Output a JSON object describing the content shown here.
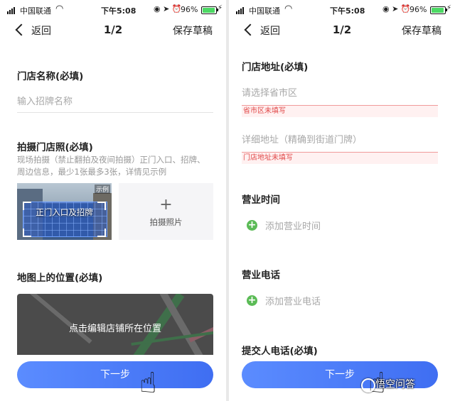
{
  "status_bar": {
    "carrier": "中国联通",
    "time": "下午5:08",
    "battery_pct": "96%",
    "battery_level": 0.96
  },
  "nav": {
    "back_label": "返回",
    "page": "1/2",
    "save_draft": "保存草稿"
  },
  "left": {
    "store_name": {
      "label": "门店名称(必填)",
      "placeholder": "输入招牌名称"
    },
    "photo": {
      "label": "拍摄门店照(必填)",
      "description": "现场拍摄（禁止翻拍及夜间拍摄）正门入口、招牌、周边信息，最少1张最多3张，详情见示例",
      "sample_caption": "正门入口及招牌",
      "sample_tag": "示例",
      "add_label": "拍摄照片",
      "add_symbol": "+"
    },
    "map": {
      "label": "地图上的位置(必填)",
      "hint": "点击编辑店铺所在位置"
    },
    "next": "下一步"
  },
  "right": {
    "address": {
      "label": "门店地址(必填)",
      "region_placeholder": "请选择省市区",
      "region_error": "省市区未填写",
      "detail_placeholder": "详细地址（精确到街道门牌）",
      "detail_error": "门店地址未填写"
    },
    "hours": {
      "label": "营业时间",
      "add": "添加营业时间"
    },
    "phone": {
      "label": "营业电话",
      "add": "添加营业电话"
    },
    "submitter_phone": {
      "label": "提交人电话(必填)"
    },
    "next": "下一步"
  },
  "watermark": "悟空问答",
  "colors": {
    "accent": "#4a7cf6",
    "error": "#e04848",
    "add_green": "#5bbb56"
  }
}
